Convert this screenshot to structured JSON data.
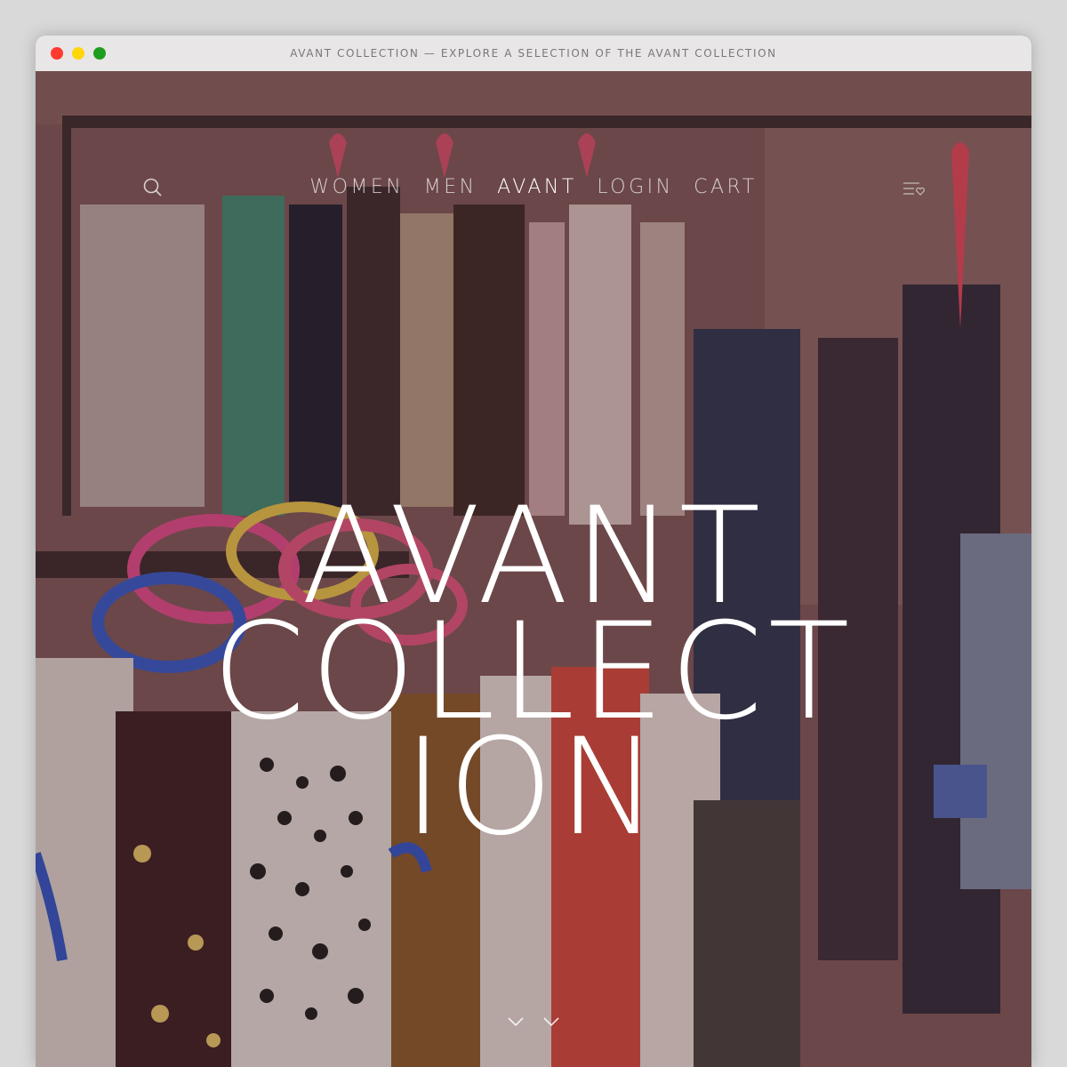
{
  "window": {
    "title": "AVANT COLLECTION — EXPLORE A SELECTION OF THE AVANT COLLECTION",
    "controls": {
      "close_color": "#ff3b30",
      "minimize_color": "#ffd60a",
      "zoom_color": "#1f9d1f"
    }
  },
  "nav": {
    "items": [
      {
        "label": "WOMEN",
        "active": false
      },
      {
        "label": "MEN",
        "active": false
      },
      {
        "label": "AVANT",
        "active": true
      },
      {
        "label": "LOGIN",
        "active": false
      },
      {
        "label": "CART",
        "active": false
      }
    ],
    "search_icon": "search-icon",
    "menu_icon": "menu-wishlist-icon"
  },
  "hero": {
    "headline_lines": [
      "AVANT",
      "COLLECT",
      "ION"
    ],
    "background": "clothing-rack-photo",
    "scroll_icon": "double-chevron-down-icon"
  }
}
